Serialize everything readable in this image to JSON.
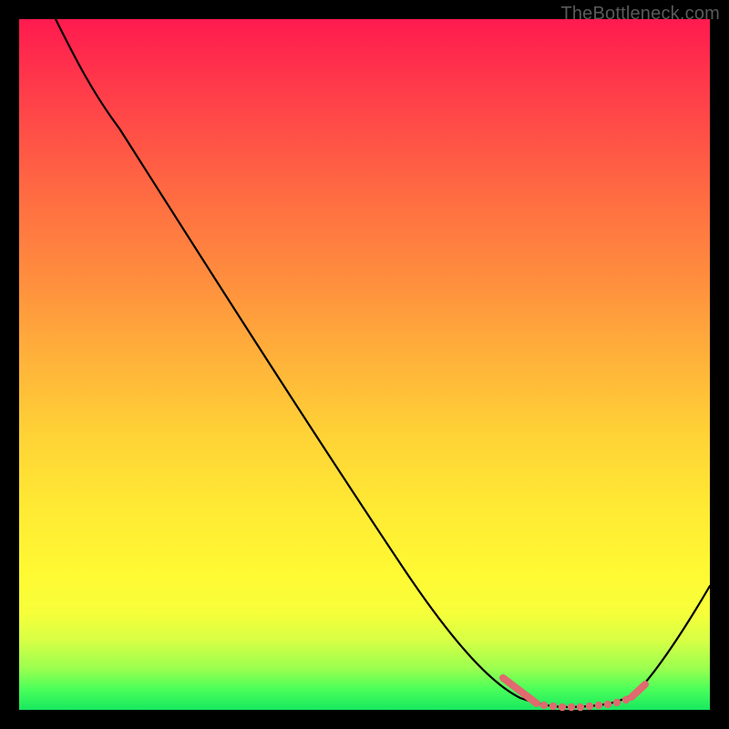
{
  "watermark": "TheBottleneck.com",
  "chart_data": {
    "type": "line",
    "title": "",
    "xlabel": "",
    "ylabel": "",
    "x": [
      0.0,
      0.05,
      0.1,
      0.15,
      0.2,
      0.25,
      0.3,
      0.35,
      0.4,
      0.45,
      0.5,
      0.55,
      0.6,
      0.65,
      0.7,
      0.73,
      0.75,
      0.78,
      0.8,
      0.82,
      0.84,
      0.86,
      0.88,
      0.9,
      0.95,
      1.0
    ],
    "values": [
      1.0,
      0.97,
      0.93,
      0.86,
      0.79,
      0.72,
      0.65,
      0.58,
      0.51,
      0.44,
      0.37,
      0.3,
      0.23,
      0.16,
      0.08,
      0.035,
      0.02,
      0.01,
      0.005,
      0.003,
      0.002,
      0.002,
      0.005,
      0.02,
      0.1,
      0.18
    ],
    "xlim": [
      0,
      1
    ],
    "ylim": [
      0,
      1
    ],
    "marker_ranges": [
      {
        "x_start": 0.705,
        "x_end": 0.755,
        "style": "diagonal"
      },
      {
        "x_start": 0.755,
        "x_end": 0.885,
        "style": "dots"
      },
      {
        "x_start": 0.885,
        "x_end": 0.905,
        "style": "diagonal"
      }
    ],
    "gradient_meaning": "vertical heat gradient (top=high, bottom=low)",
    "description": "Black V-shaped curve over full-area red-to-green vertical gradient. Salmon-colored markers highlight the valley region near the minimum."
  }
}
